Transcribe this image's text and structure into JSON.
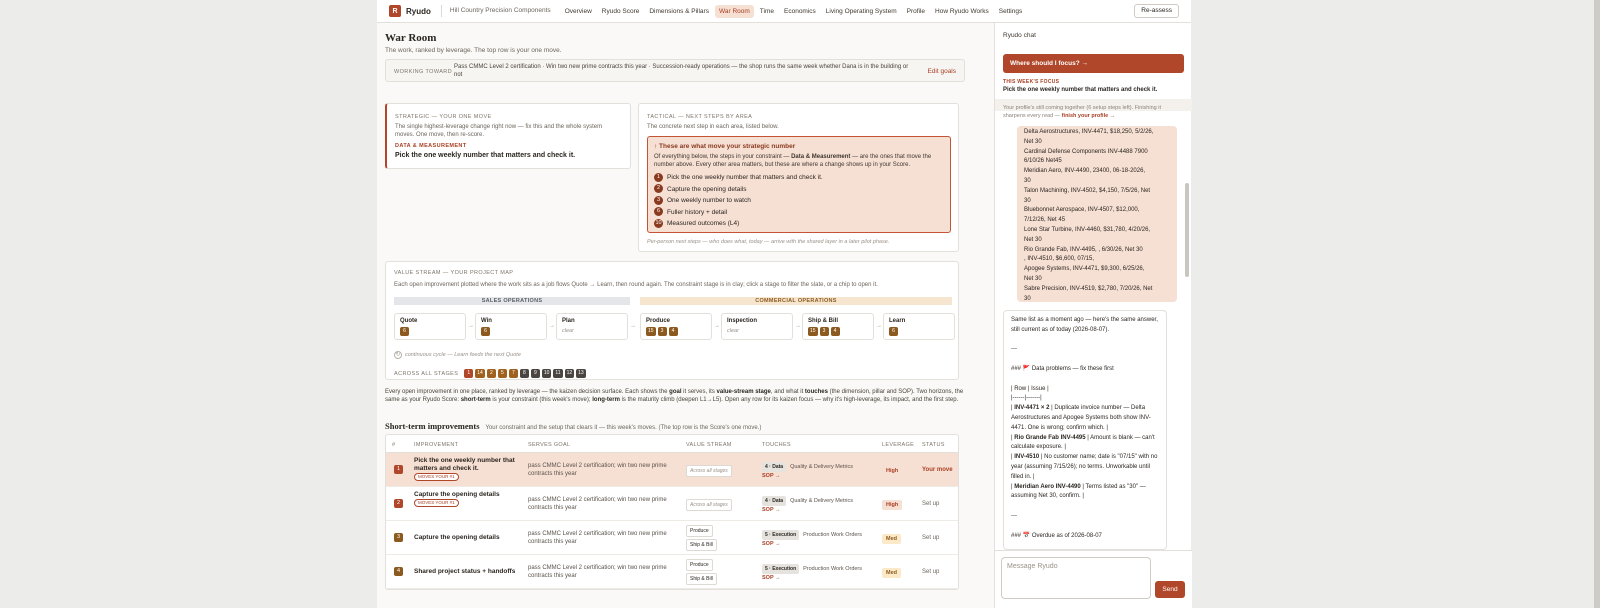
{
  "topnav": {
    "logo_letter": "R",
    "brand": "Ryudo",
    "company": "Hill Country Precision Components",
    "links": [
      "Overview",
      "Ryudo Score",
      "Dimensions & Pillars",
      "War Room",
      "Time",
      "Economics",
      "Living Operating System",
      "Profile",
      "How Ryudo Works",
      "Settings"
    ],
    "active": "War Room",
    "reassess": "Re-assess"
  },
  "page": {
    "title": "War Room",
    "subtitle": "The work, ranked by leverage. The top row is your one move.",
    "working_toward_label": "WORKING TOWARD",
    "working_toward_text": "Pass CMMC Level 2 certification · Win two new prime contracts this year · Succession-ready operations — the shop runs the same week whether Dana is in the building or not",
    "edit_goals": "Edit goals"
  },
  "strategic": {
    "kicker": "STRATEGIC — YOUR ONE MOVE",
    "desc": "The single highest-leverage change right now — fix this and the whole system moves. One move, then re-score.",
    "area": "DATA & MEASUREMENT",
    "move": "Pick the one weekly number that matters and check it."
  },
  "tactical": {
    "kicker": "TACTICAL — NEXT STEPS BY AREA",
    "desc": "The concrete next step in each area, listed below.",
    "box_title": "↑ These are what move your strategic number",
    "box_desc_1": "Of everything below, the steps in your constraint — ",
    "box_desc_bold": "Data & Measurement",
    "box_desc_2": " — are the ones that move the number above. Every other area matters, but these are where a change shows up in your Score.",
    "steps": [
      {
        "n": "1",
        "label": "Pick the one weekly number that matters and check it."
      },
      {
        "n": "2",
        "label": "Capture the opening details"
      },
      {
        "n": "3",
        "label": "One weekly number to watch"
      },
      {
        "n": "6",
        "label": "Fuller history + detail"
      },
      {
        "n": "10",
        "label": "Measured outcomes (L4)"
      }
    ],
    "footnote": "Per-person next steps — who does what, today — arrive with the shared layer in a later pilot phase."
  },
  "value_stream": {
    "kicker": "VALUE STREAM — YOUR PROJECT MAP",
    "desc": "Each open improvement plotted where the work sits as a job flows Quote → Learn, then round again. The constraint stage is in clay; click a stage to filter the slate, or a chip to open it.",
    "band_sales": "SALES OPERATIONS",
    "band_commercial": "COMMERCIAL OPERATIONS",
    "stages": [
      {
        "name": "Quote",
        "chips": [
          "6"
        ]
      },
      {
        "name": "Win",
        "chips": [
          "6"
        ]
      },
      {
        "name": "Plan",
        "chips": [],
        "clear": "clear"
      },
      {
        "name": "Produce",
        "chips": [
          "15",
          "3",
          "4"
        ]
      },
      {
        "name": "Inspection",
        "chips": [],
        "clear": "clear"
      },
      {
        "name": "Ship & Bill",
        "chips": [
          "15",
          "3",
          "4"
        ]
      },
      {
        "name": "Learn",
        "chips": [
          "6"
        ]
      }
    ],
    "cycle_note": "continuous cycle — Learn feeds the next Quote",
    "across_label": "ACROSS ALL STAGES",
    "across_chips": [
      "1",
      "14",
      "2",
      "5",
      "7",
      "8",
      "9",
      "10",
      "11",
      "12",
      "13"
    ]
  },
  "intro_para": {
    "t1": "Every open improvement in one place, ranked by leverage — the kaizen decision surface. Each shows the ",
    "b1": "goal",
    "t2": " it serves, its ",
    "b2": "value-stream stage",
    "t3": ", and what it ",
    "b3": "touches",
    "t4": " (the dimension, pillar and SOP). Two horizons, the same as your Ryudo Score: ",
    "b4": "short-term",
    "t5": " is your constraint (this week's move); ",
    "b5": "long-term",
    "t6": " is the maturity climb (deepen L1→L5). Open any row for its kaizen focus — why it's high-leverage, its impact, and the first step."
  },
  "short_term": {
    "title": "Short-term improvements",
    "subtitle": "Your constraint and the setup that clears it — this week's moves. (The top row is the Score's one move.)",
    "headers": [
      "#",
      "IMPROVEMENT",
      "SERVES GOAL",
      "VALUE STREAM",
      "TOUCHES",
      "LEVERAGE",
      "STATUS"
    ],
    "rows": [
      {
        "n": "1",
        "title": "Pick the one weekly number that matters and check it.",
        "badge": "MOVES YOUR #1",
        "goal": "pass CMMC Level 2 certification; win two new prime contracts this year",
        "stream": [
          "Across all stages"
        ],
        "pill": "4 · Data",
        "touch": "Quality & Delivery Metrics",
        "sop": "SOP →",
        "lev": "High",
        "status": "Your move"
      },
      {
        "n": "2",
        "title": "Capture the opening details",
        "badge": "MOVES YOUR #1",
        "goal": "pass CMMC Level 2 certification; win two new prime contracts this year",
        "stream": [
          "Across all stages"
        ],
        "pill": "4 · Data",
        "touch": "Quality & Delivery Metrics",
        "sop": "SOP →",
        "lev": "High",
        "status": "Set up"
      },
      {
        "n": "3",
        "title": "Capture the opening details",
        "badge": "",
        "goal": "pass CMMC Level 2 certification; win two new prime contracts this year",
        "stream": [
          "Produce",
          "Ship & Bill"
        ],
        "pill": "5 · Execution",
        "touch": "Production Work Orders",
        "sop": "SOP →",
        "lev": "Med",
        "status": "Set up"
      },
      {
        "n": "4",
        "title": "Shared project status + handoffs",
        "badge": "",
        "goal": "pass CMMC Level 2 certification; win two new prime contracts this year",
        "stream": [
          "Produce",
          "Ship & Bill"
        ],
        "pill": "5 · Execution",
        "touch": "Production Work Orders",
        "sop": "SOP →",
        "lev": "Med",
        "status": "Set up"
      }
    ]
  },
  "chat": {
    "header": "Ryudo chat",
    "focus_button": "Where should I focus? →",
    "week_label": "THIS WEEK'S FOCUS",
    "week_focus": "Pick the one weekly number that matters and check it.",
    "profile_note": "Your profile's still coming together (6 setup steps left). Finishing it sharpens every read — ",
    "profile_link": "finish your profile →",
    "user_lines": [
      "Delta Aerostructures, INV-4471, $18,250, 5/2/26,",
      "Net 30",
      "Cardinal Defense Components INV-4488 7900",
      "6/10/26 Net45",
      "Meridian Aero, INV-4490, 23400, 06-18-2026,",
      "30",
      "Talon Machining, INV-4502, $4,150, 7/5/26, Net",
      "30",
      "Bluebonnet Aerospace, INV-4507, $12,000,",
      "7/12/26, Net 45",
      "Lone Star Turbine, INV-4460, $31,780, 4/20/26,",
      "Net 30",
      "Rio Grande Fab, INV-4495, , 6/30/26, Net 30",
      ", INV-4510, $6,600, 07/15,",
      "Apogee Systems, INV-4471, $9,300, 6/25/26,",
      "Net 30",
      "Sabre Precision, INV-4519, $2,780, 7/20/26, Net",
      "30"
    ],
    "bot_lines": [
      {
        "t": "Same list as a moment ago — here's the same answer, still current as of today (2026-08-07)."
      },
      {
        "t": ""
      },
      {
        "t": "---"
      },
      {
        "t": ""
      },
      {
        "t": "### 🚩 Data problems — fix these first"
      },
      {
        "t": ""
      },
      {
        "t": "| Row | Issue |"
      },
      {
        "t": "|------|-------|"
      },
      {
        "b": "INV-4471 × 2",
        "t": " | Duplicate invoice number — Delta Aerostructures and Apogee Systems both show INV-4471. One is wrong; confirm which. |",
        "pre": "| "
      },
      {
        "b": "Rio Grande Fab INV-4495",
        "t": " | Amount is blank — can't calculate exposure. |",
        "pre": "| "
      },
      {
        "b": "INV-4510",
        "t": " | No customer name; date is \"07/15\" with no year (assuming 7/15/26); no terms. Unworkable until filled in. |",
        "pre": "| "
      },
      {
        "b": "Meridian Aero INV-4490",
        "t": " | Terms listed as \"30\" — assuming Net 30, confirm. |",
        "pre": "| "
      },
      {
        "t": ""
      },
      {
        "t": "---"
      },
      {
        "t": ""
      },
      {
        "t": "### 📅 Overdue as of 2026-08-07"
      }
    ],
    "input_placeholder": "Message Ryudo",
    "send": "Send"
  }
}
